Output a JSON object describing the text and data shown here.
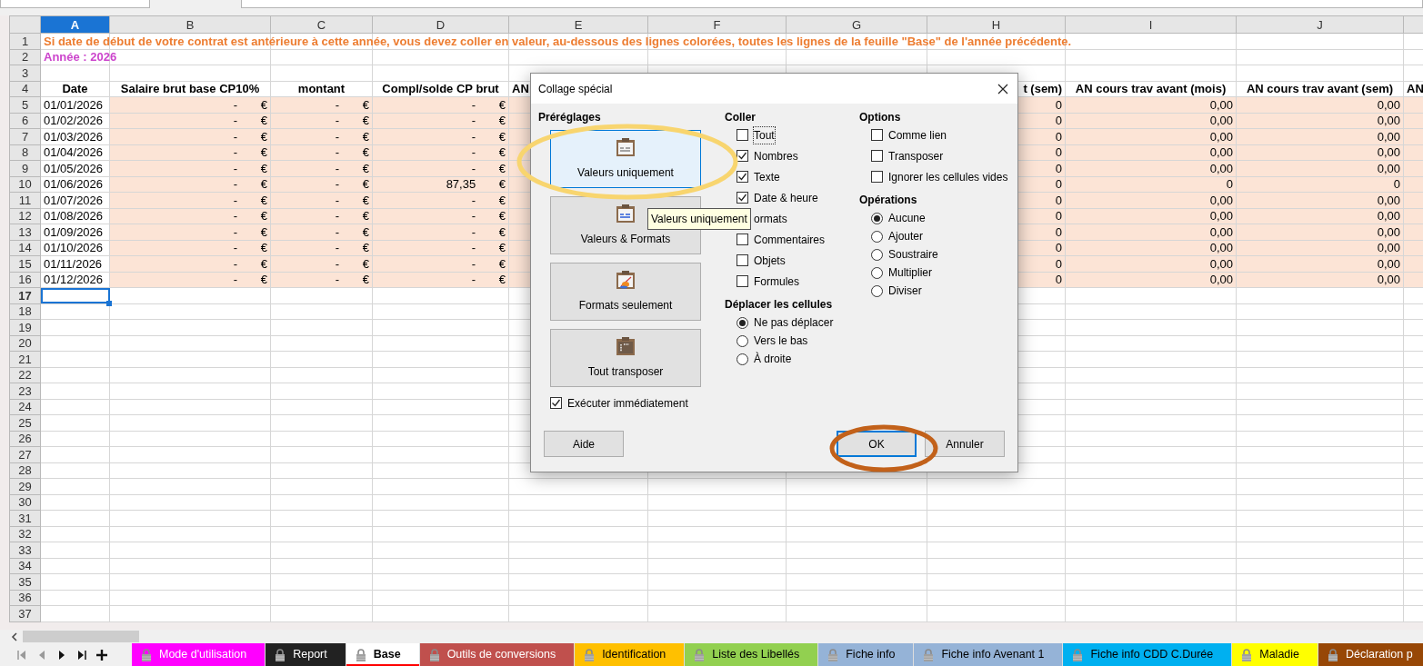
{
  "sheet": {
    "columns": [
      {
        "label": "A",
        "selected": true,
        "kind": "date"
      },
      {
        "label": "B",
        "selected": false,
        "kind": "currency"
      },
      {
        "label": "C",
        "selected": false,
        "kind": "currency"
      },
      {
        "label": "D",
        "selected": false,
        "kind": "currency"
      },
      {
        "label": "E",
        "selected": false
      },
      {
        "label": "F",
        "selected": false
      },
      {
        "label": "G",
        "selected": false
      },
      {
        "label": "H",
        "selected": false,
        "kind": "number"
      },
      {
        "label": "I",
        "selected": false,
        "kind": "number"
      },
      {
        "label": "J",
        "selected": false,
        "kind": "number"
      },
      {
        "selected": false
      }
    ],
    "rows": [
      {
        "number": "1",
        "selected": false,
        "kind": "notice",
        "cells": [
          "Si date de début de votre contrat est antérieure à cette année, vous devez coller en valeur, au-dessous des lignes colorées, toutes les lignes de la feuille \"Base\" de l'année précédente."
        ]
      },
      {
        "number": "2",
        "selected": false,
        "kind": "title",
        "cells": [
          "Année : 2026"
        ]
      },
      {
        "number": "3",
        "selected": false,
        "kind": "empty"
      },
      {
        "number": "4",
        "selected": false,
        "kind": "header",
        "cells": [
          "Date",
          "Salaire brut base CP10%",
          "montant",
          "Compl/solde CP brut",
          {
            "text": "AN",
            "kind": "cut_end"
          },
          null,
          null,
          {
            "text": "t (sem)",
            "kind": "cut_start"
          },
          "AN cours trav avant (mois)",
          "AN cours trav avant (sem)",
          {
            "text": "AN",
            "kind": "cut_end"
          }
        ]
      },
      {
        "number": "5",
        "selected": false,
        "kind": "data",
        "cells": [
          "01/01/2026",
          "- €",
          "- €",
          "- €",
          null,
          null,
          null,
          "0",
          "0,00",
          "0,00",
          null
        ]
      },
      {
        "number": "6",
        "selected": false,
        "kind": "data",
        "cells": [
          "01/02/2026",
          "- €",
          "- €",
          "- €",
          null,
          null,
          null,
          "0",
          "0,00",
          "0,00",
          null
        ]
      },
      {
        "number": "7",
        "selected": false,
        "kind": "data",
        "cells": [
          "01/03/2026",
          "- €",
          "- €",
          "- €",
          null,
          null,
          null,
          "0",
          "0,00",
          "0,00",
          null
        ]
      },
      {
        "number": "8",
        "selected": false,
        "kind": "data",
        "cells": [
          "01/04/2026",
          "- €",
          "- €",
          "- €",
          null,
          null,
          null,
          "0",
          "0,00",
          "0,00",
          null
        ]
      },
      {
        "number": "9",
        "selected": false,
        "kind": "data",
        "cells": [
          "01/05/2026",
          "- €",
          "- €",
          "- €",
          null,
          null,
          null,
          "0",
          "0,00",
          "0,00",
          null
        ]
      },
      {
        "number": "10",
        "selected": false,
        "kind": "data",
        "cells": [
          "01/06/2026",
          "- €",
          "- €",
          "87,35 €",
          null,
          null,
          null,
          "0",
          "0",
          "0",
          null
        ]
      },
      {
        "number": "11",
        "selected": false,
        "kind": "data",
        "cells": [
          "01/07/2026",
          "- €",
          "- €",
          "- €",
          null,
          null,
          null,
          "0",
          "0,00",
          "0,00",
          null
        ]
      },
      {
        "number": "12",
        "selected": false,
        "kind": "data",
        "cells": [
          "01/08/2026",
          "- €",
          "- €",
          "- €",
          null,
          null,
          null,
          "0",
          "0,00",
          "0,00",
          null
        ]
      },
      {
        "number": "13",
        "selected": false,
        "kind": "data",
        "cells": [
          "01/09/2026",
          "- €",
          "- €",
          "- €",
          null,
          null,
          null,
          "0",
          "0,00",
          "0,00",
          null
        ]
      },
      {
        "number": "14",
        "selected": false,
        "kind": "data",
        "cells": [
          "01/10/2026",
          "- €",
          "- €",
          "- €",
          null,
          null,
          null,
          "0",
          "0,00",
          "0,00",
          null
        ]
      },
      {
        "number": "15",
        "selected": false,
        "kind": "data",
        "cells": [
          "01/11/2026",
          "- €",
          "- €",
          "- €",
          null,
          null,
          null,
          "0",
          "0,00",
          "0,00",
          null
        ]
      },
      {
        "number": "16",
        "selected": false,
        "kind": "data",
        "cells": [
          "01/12/2026",
          "- €",
          "- €",
          "- €",
          null,
          null,
          null,
          "0",
          "0,00",
          "0,00",
          null
        ]
      },
      {
        "number": "17",
        "selected": true,
        "kind": "empty"
      },
      {
        "number": "18",
        "selected": false,
        "kind": "empty"
      },
      {
        "number": "19",
        "selected": false,
        "kind": "empty"
      },
      {
        "number": "20",
        "selected": false,
        "kind": "empty"
      },
      {
        "number": "21",
        "selected": false,
        "kind": "empty"
      },
      {
        "number": "22",
        "selected": false,
        "kind": "empty"
      },
      {
        "number": "23",
        "selected": false,
        "kind": "empty"
      },
      {
        "number": "24",
        "selected": false,
        "kind": "empty"
      },
      {
        "number": "25",
        "selected": false,
        "kind": "empty"
      },
      {
        "number": "26",
        "selected": false,
        "kind": "empty"
      },
      {
        "number": "27",
        "selected": false,
        "kind": "empty"
      },
      {
        "number": "28",
        "selected": false,
        "kind": "empty"
      },
      {
        "number": "29",
        "selected": false,
        "kind": "empty"
      },
      {
        "number": "30",
        "selected": false,
        "kind": "empty"
      },
      {
        "number": "31",
        "selected": false,
        "kind": "empty"
      },
      {
        "number": "32",
        "selected": false,
        "kind": "empty"
      },
      {
        "number": "33",
        "selected": false,
        "kind": "empty"
      },
      {
        "number": "34",
        "selected": false,
        "kind": "empty"
      },
      {
        "number": "35",
        "selected": false,
        "kind": "empty"
      },
      {
        "number": "36",
        "selected": false,
        "kind": "empty"
      },
      {
        "number": "37",
        "selected": false,
        "kind": "empty"
      }
    ]
  },
  "dialog": {
    "title": "Collage spécial",
    "presets_label": "Préréglages",
    "presets": [
      {
        "label": "Valeurs uniquement",
        "selected": true,
        "kind": "values"
      },
      {
        "label": "Valeurs & Formats",
        "selected": false,
        "kind": "values_formats"
      },
      {
        "label": "Formats seulement",
        "selected": false,
        "kind": "formats"
      },
      {
        "label": "Tout transposer",
        "selected": false,
        "kind": "transpose"
      }
    ],
    "run_immediately": {
      "label": "Exécuter immédiatement",
      "checked": true
    },
    "paste": {
      "label": "Coller",
      "items": [
        {
          "label": "Tout",
          "checked": false,
          "focused": true
        },
        {
          "label": "Nombres",
          "checked": true,
          "focused": false
        },
        {
          "label": "Texte",
          "checked": true,
          "focused": false
        },
        {
          "label": "Date & heure",
          "checked": true,
          "focused": false
        },
        {
          "label": "ormats",
          "focused": false
        },
        {
          "label": "Commentaires",
          "checked": false,
          "focused": false
        },
        {
          "label": "Objets",
          "checked": false,
          "focused": false
        },
        {
          "label": "Formules",
          "checked": false,
          "focused": false
        }
      ]
    },
    "shift": {
      "label": "Déplacer les cellules",
      "items": [
        {
          "label": "Ne pas déplacer",
          "selected": true
        },
        {
          "label": "Vers le bas",
          "selected": false
        },
        {
          "label": "À droite",
          "selected": false
        }
      ]
    },
    "options": {
      "label": "Options",
      "items": [
        {
          "label": "Comme lien",
          "checked": false
        },
        {
          "label": "Transposer",
          "checked": false
        },
        {
          "label": "Ignorer les cellules vides",
          "checked": false
        }
      ]
    },
    "operations": {
      "label": "Opérations",
      "items": [
        {
          "label": "Aucune",
          "selected": true
        },
        {
          "label": "Ajouter",
          "selected": false
        },
        {
          "label": "Soustraire",
          "selected": false
        },
        {
          "label": "Multiplier",
          "selected": false
        },
        {
          "label": "Diviser",
          "selected": false
        }
      ]
    },
    "buttons": [
      {
        "label": "Aide",
        "default": false
      },
      {
        "label": "OK",
        "default": true
      },
      {
        "label": "Annuler",
        "default": false
      }
    ],
    "tooltip": "Valeurs uniquement"
  },
  "sheet_tabs": [
    {
      "label": "Mode d'utilisation",
      "color": "#ff00ff",
      "selected": false
    },
    {
      "label": "Report",
      "color": "#222222",
      "selected": false
    },
    {
      "label": "Base",
      "color": "#ff0000",
      "selected": true
    },
    {
      "label": "Outils de conversions",
      "color": "#c0504d",
      "selected": false
    },
    {
      "label": "Identification",
      "color": "#ffc000",
      "selected": false
    },
    {
      "label": "Liste des Libellés",
      "color": "#92d050",
      "selected": false
    },
    {
      "label": "Fiche info",
      "color": "#95b3d7",
      "selected": false
    },
    {
      "label": "Fiche info Avenant 1",
      "color": "#95b3d7",
      "selected": false
    },
    {
      "label": "Fiche info CDD C.Durée",
      "color": "#00b0f0",
      "selected": false
    },
    {
      "label": "Maladie",
      "color": "#ffff00",
      "selected": false
    },
    {
      "label": "Déclaration p",
      "color": "#974706",
      "selected": false
    }
  ]
}
